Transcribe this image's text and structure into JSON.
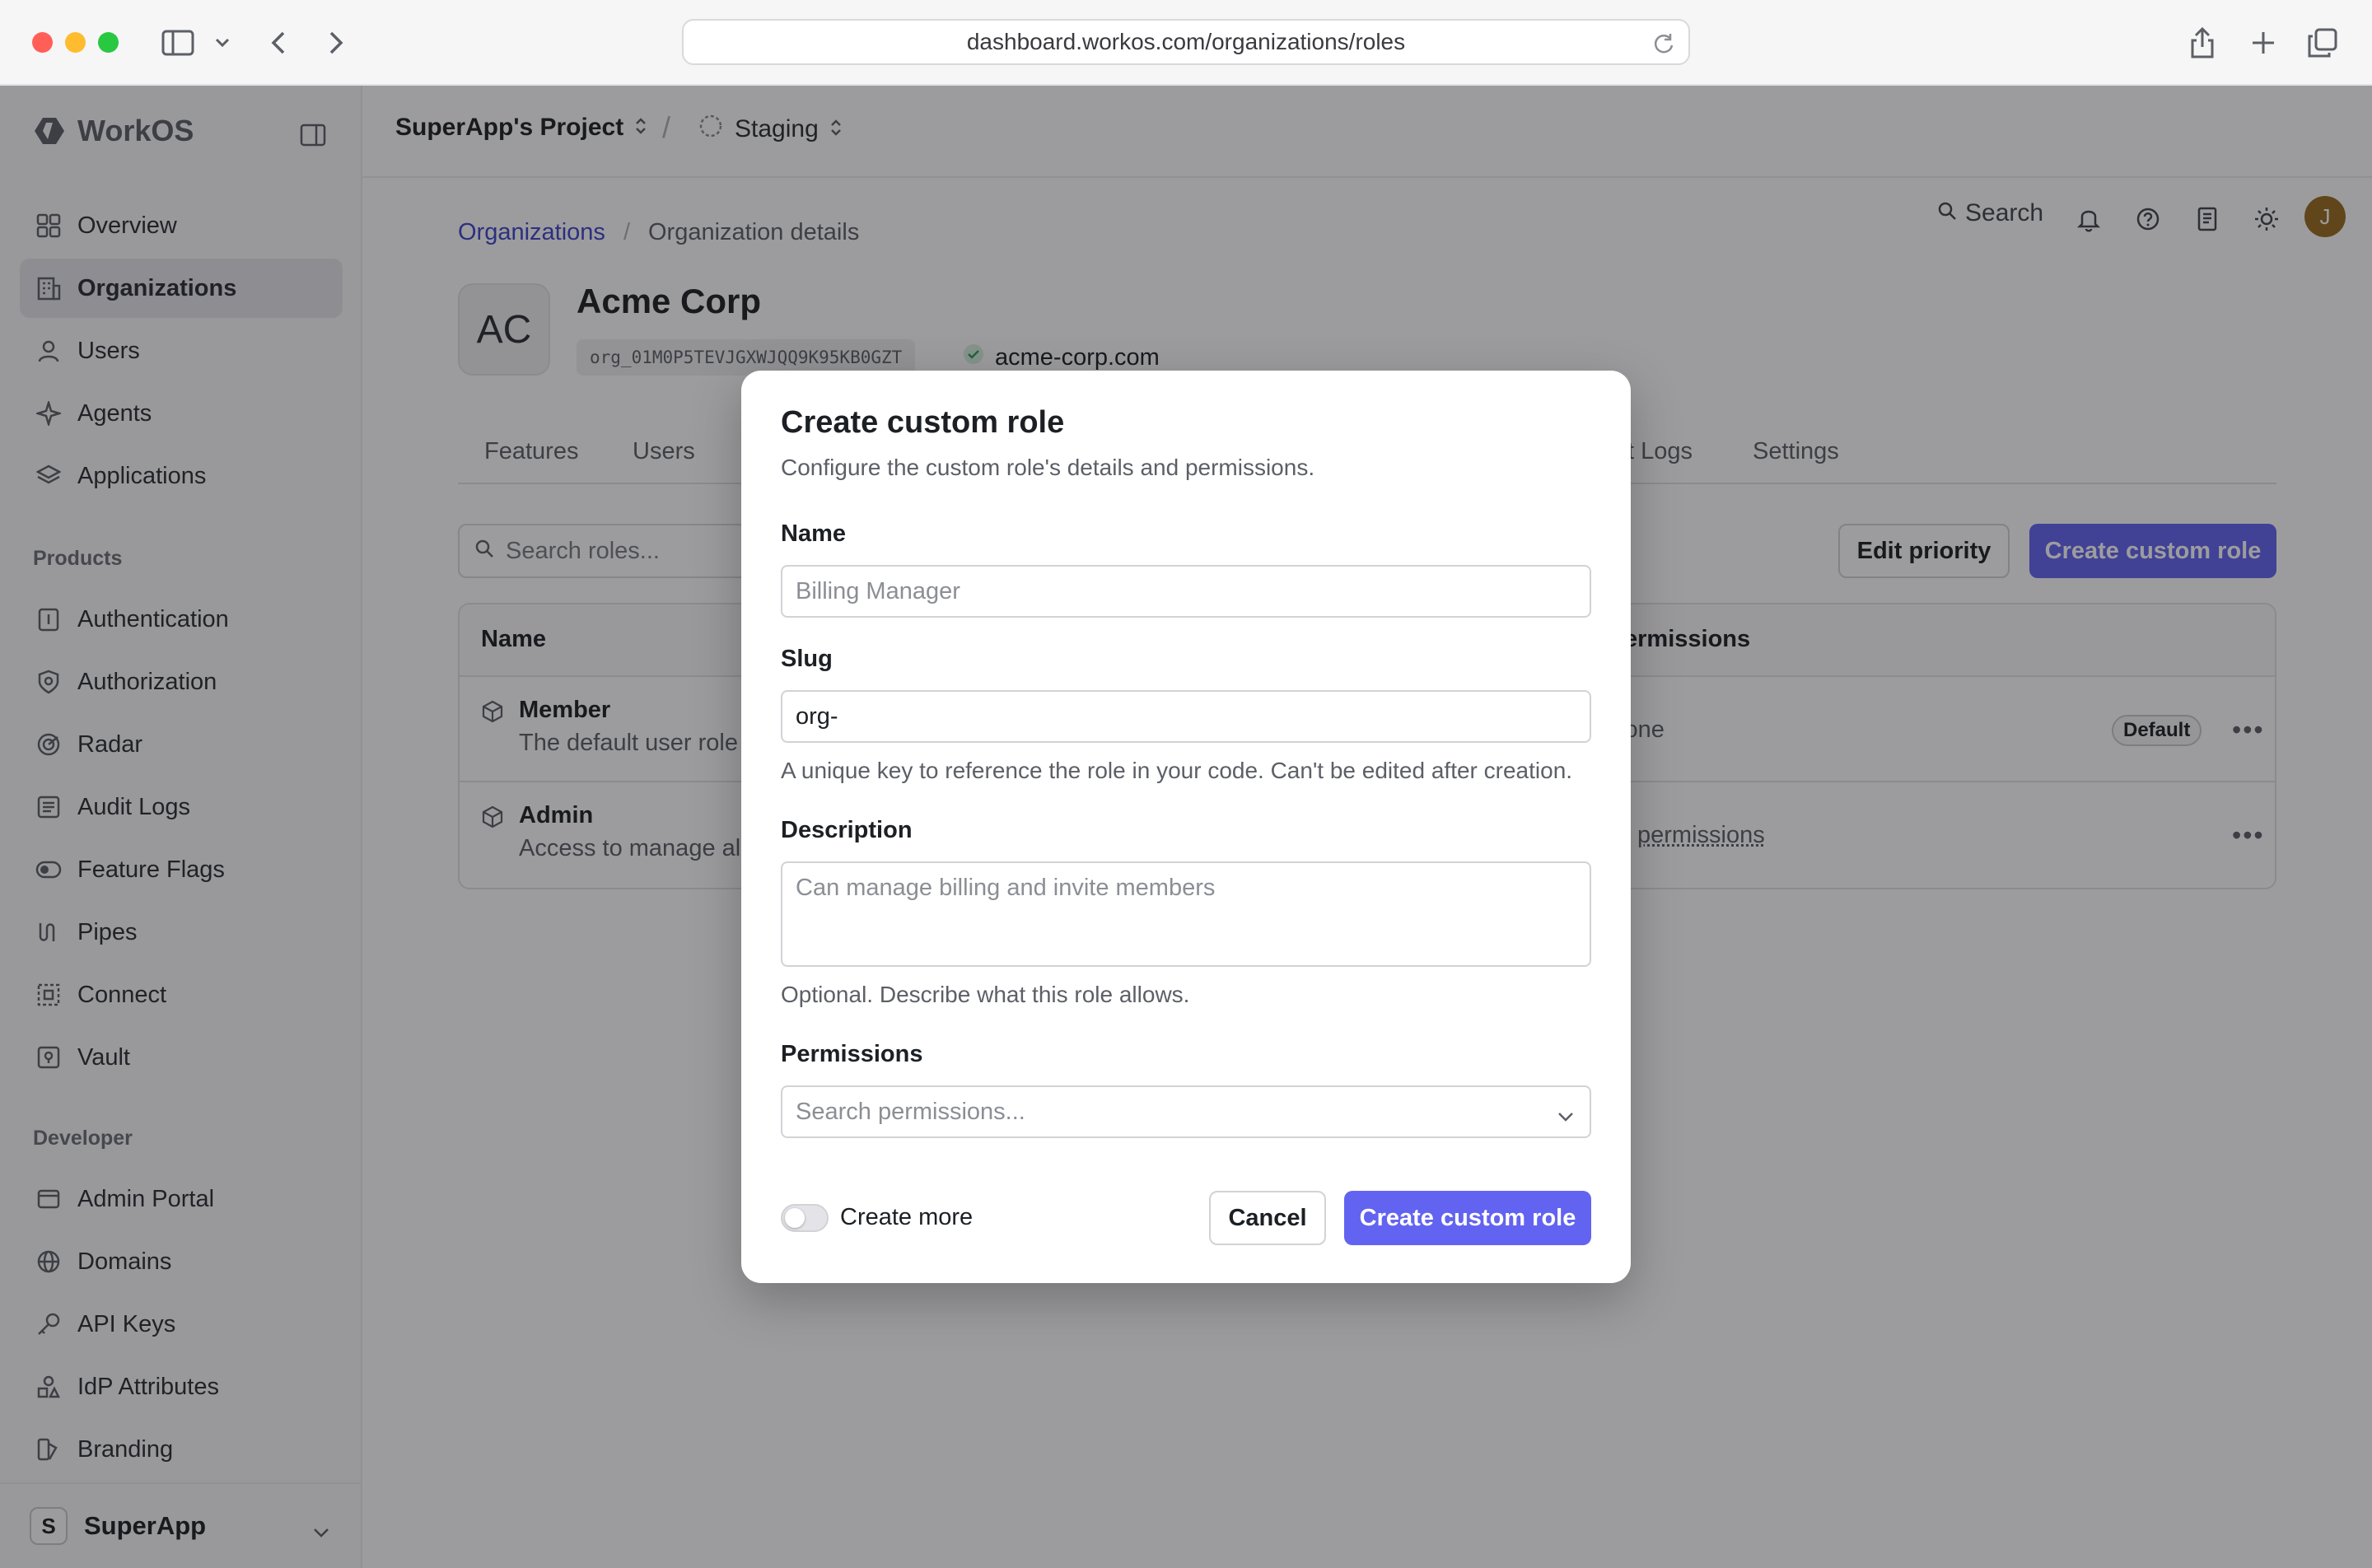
{
  "browser": {
    "url": "dashboard.workos.com/organizations/roles"
  },
  "sidebar": {
    "brand": "WorkOS",
    "items": [
      {
        "label": "Overview"
      },
      {
        "label": "Organizations"
      },
      {
        "label": "Users"
      },
      {
        "label": "Agents"
      },
      {
        "label": "Applications"
      }
    ],
    "products_title": "Products",
    "products": [
      {
        "label": "Authentication"
      },
      {
        "label": "Authorization"
      },
      {
        "label": "Radar"
      },
      {
        "label": "Audit Logs"
      },
      {
        "label": "Feature Flags"
      },
      {
        "label": "Pipes"
      },
      {
        "label": "Connect"
      },
      {
        "label": "Vault"
      }
    ],
    "developer_title": "Developer",
    "developer": [
      {
        "label": "Admin Portal"
      },
      {
        "label": "Domains"
      },
      {
        "label": "API Keys"
      },
      {
        "label": "IdP Attributes"
      },
      {
        "label": "Branding"
      }
    ],
    "team": {
      "initial": "S",
      "name": "SuperApp"
    }
  },
  "topbar": {
    "project": "SuperApp's Project",
    "environment": "Staging",
    "search_label": "Search",
    "avatar_initial": "J"
  },
  "page": {
    "breadcrumb": [
      "Organizations",
      "Organization details"
    ],
    "org_initials": "AC",
    "org_name": "Acme Corp",
    "org_id": "org_01M0P5TEVJGXWJQQ9K95KB0GZT",
    "org_domain": "acme-corp.com",
    "tabs": [
      "Features",
      "Users",
      "t Logs",
      "Settings"
    ],
    "search_placeholder": "Search roles...",
    "edit_priority": "Edit priority",
    "create_role": "Create custom role",
    "table": {
      "col_name": "Name",
      "col_permissions": "ermissions",
      "rows": [
        {
          "name": "Member",
          "desc": "The default user role",
          "perm": "lone",
          "badge": "Default"
        },
        {
          "name": "Admin",
          "desc": "Access to manage all",
          "perm": "permissions"
        }
      ]
    }
  },
  "modal": {
    "title": "Create custom role",
    "subtitle": "Configure the custom role's details and permissions.",
    "name_label": "Name",
    "name_placeholder": "Billing Manager",
    "slug_label": "Slug",
    "slug_value": "org-",
    "slug_hint": "A unique key to reference the role in your code. Can't be edited after creation.",
    "description_label": "Description",
    "description_placeholder": "Can manage billing and invite members",
    "description_hint": "Optional. Describe what this role allows.",
    "permissions_label": "Permissions",
    "permissions_placeholder": "Search permissions...",
    "create_more_label": "Create more",
    "create_more_on": false,
    "cancel": "Cancel",
    "submit": "Create custom role"
  },
  "colors": {
    "accent": "#6363f1",
    "link": "#3e45c9"
  }
}
